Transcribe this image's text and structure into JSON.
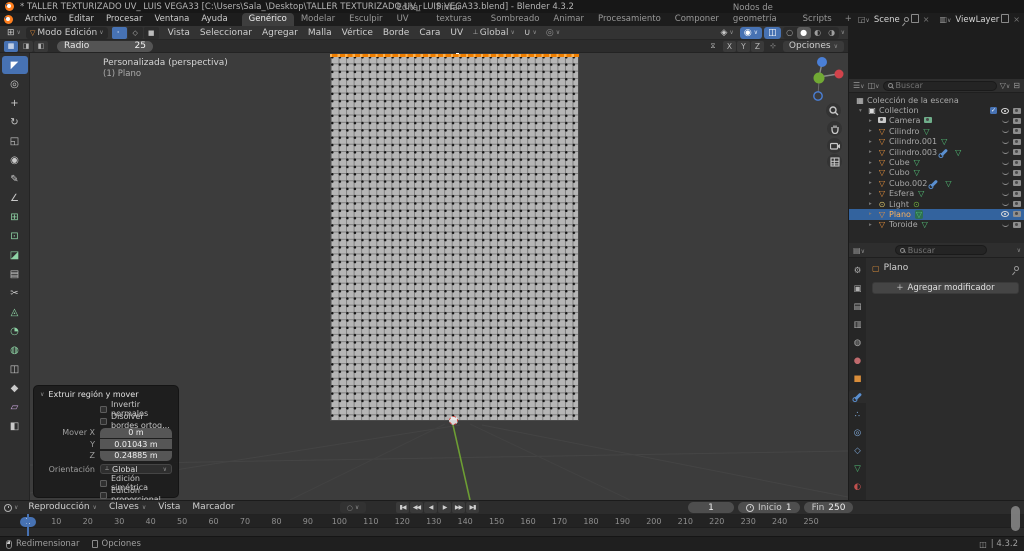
{
  "colors": {
    "accent_blue": "#4772b3",
    "selection_orange": "#ff9a2a",
    "mesh_data_green": "#53c278",
    "object_orange": "#e8913c",
    "axis_x_red": "#d1434b",
    "axis_y_green": "#71a934",
    "axis_z_blue": "#4a7fd6"
  },
  "titlebar": {
    "title": "* TALLER TEXTURIZADO UV_ LUIS VEGA33 [C:\\Users\\Sala_\\Desktop\\TALLER TEXTURIZADO UV_ LUIS VEGA33.blend] - Blender 4.3.2"
  },
  "topbar": {
    "menus": [
      "Archivo",
      "Editar",
      "Procesar",
      "Ventana",
      "Ayuda"
    ],
    "workspaces": [
      "Genérico",
      "Modelar",
      "Esculpir",
      "Editar UV",
      "Pintar texturas",
      "Sombreado",
      "Animar",
      "Procesamiento",
      "Componer",
      "Nodos de geometría",
      "Scripts"
    ],
    "active_workspace": "Genérico",
    "new_workspace_button": "+",
    "scene_label": "Scene",
    "viewlayer_label": "ViewLayer"
  },
  "viewport_header": {
    "mode_label": "Modo Edición",
    "menus": [
      "Vista",
      "Seleccionar",
      "Agregar",
      "Malla",
      "Vértice",
      "Borde",
      "Cara",
      "UV"
    ],
    "orientation_label": "Global",
    "select_mode_glyphs": [
      "⠂",
      "◇",
      "■"
    ],
    "shading_glyphs": [
      "○",
      "●",
      "◐",
      "◑"
    ],
    "active_shading_index": 1
  },
  "tool_settings": {
    "radius_label": "Radio",
    "radius_value": "25",
    "mirror_axes": [
      "X",
      "Y",
      "Z"
    ],
    "options_label": "Opciones"
  },
  "toolbar": {
    "tools": [
      {
        "name": "select-box",
        "glyph": "◤",
        "color": "#ffffff",
        "active": true
      },
      {
        "name": "cursor",
        "glyph": "◎",
        "color": "#c9c9c9"
      },
      {
        "name": "move",
        "glyph": "+",
        "color": "#c9c9c9"
      },
      {
        "name": "rotate",
        "glyph": "↻",
        "color": "#c9c9c9"
      },
      {
        "name": "scale",
        "glyph": "◱",
        "color": "#c9c9c9"
      },
      {
        "name": "transform",
        "glyph": "◉",
        "color": "#c9c9c9"
      },
      {
        "name": "annotate",
        "glyph": "✎",
        "color": "#c9c9c9"
      },
      {
        "name": "measure",
        "glyph": "∠",
        "color": "#c9c9c9"
      },
      {
        "name": "extrude-region",
        "glyph": "⊞",
        "color": "#8fd5a6"
      },
      {
        "name": "inset-faces",
        "glyph": "⊡",
        "color": "#8fd5a6"
      },
      {
        "name": "bevel",
        "glyph": "◪",
        "color": "#8fd5a6"
      },
      {
        "name": "loop-cut",
        "glyph": "▤",
        "color": "#c9c9c9"
      },
      {
        "name": "knife",
        "glyph": "✂",
        "color": "#c9c9c9"
      },
      {
        "name": "poly-build",
        "glyph": "◬",
        "color": "#8fd5a6"
      },
      {
        "name": "spin",
        "glyph": "◔",
        "color": "#8fd5a6"
      },
      {
        "name": "smooth",
        "glyph": "◍",
        "color": "#8fd5a6"
      },
      {
        "name": "edge-slide",
        "glyph": "◫",
        "color": "#c9c9c9"
      },
      {
        "name": "shrink-fatten",
        "glyph": "◆",
        "color": "#c9c9c9"
      },
      {
        "name": "shear",
        "glyph": "▱",
        "color": "#cda9e0"
      },
      {
        "name": "rip-region",
        "glyph": "◧",
        "color": "#c9c9c9"
      }
    ]
  },
  "viewport": {
    "view_name": "Personalizada (perspectiva)",
    "active_object": "(1) Plano"
  },
  "operator_panel": {
    "title": "Extruir región y mover",
    "checkbox_invert": "Invertir normales",
    "checkbox_dissolve": "Disolver bordes ortog...",
    "move_x_label": "Mover X",
    "move_x_value": "0 m",
    "move_y_label": "Y",
    "move_y_value": "0.01043 m",
    "move_z_label": "Z",
    "move_z_value": "0.24885 m",
    "orientation_label": "Orientación",
    "orientation_value": "Global",
    "checkbox_symmetric": "Edición simétrica",
    "checkbox_proportional": "Edición proporcional"
  },
  "outliner": {
    "search_placeholder": "Buscar",
    "scene_collection_label": "Colección de la escena",
    "collection_label": "Collection",
    "items": [
      {
        "name": "Camera",
        "type": "camera",
        "has_modifier": false,
        "selected": false
      },
      {
        "name": "Cilindro",
        "type": "mesh",
        "has_modifier": false,
        "selected": false
      },
      {
        "name": "Cilindro.001",
        "type": "mesh",
        "has_modifier": false,
        "selected": false
      },
      {
        "name": "Cilindro.003",
        "type": "mesh",
        "has_modifier": true,
        "selected": false
      },
      {
        "name": "Cube",
        "type": "mesh",
        "has_modifier": false,
        "selected": false
      },
      {
        "name": "Cubo",
        "type": "mesh",
        "has_modifier": false,
        "selected": false
      },
      {
        "name": "Cubo.002",
        "type": "mesh",
        "has_modifier": true,
        "selected": false
      },
      {
        "name": "Esfera",
        "type": "mesh",
        "has_modifier": false,
        "selected": false
      },
      {
        "name": "Light",
        "type": "light",
        "has_modifier": false,
        "selected": false
      },
      {
        "name": "Plano",
        "type": "mesh",
        "has_modifier": false,
        "selected": true
      },
      {
        "name": "Toroide",
        "type": "mesh",
        "has_modifier": false,
        "selected": false
      }
    ]
  },
  "properties": {
    "search_placeholder": "Buscar",
    "breadcrumb_object": "Plano",
    "add_modifier_label": "Agregar modificador",
    "tabs": [
      {
        "name": "tool",
        "glyph": "⚙",
        "color": "#b0b0b0",
        "active": false
      },
      {
        "name": "render",
        "glyph": "▣",
        "color": "#b0b0b0",
        "active": false
      },
      {
        "name": "output",
        "glyph": "▤",
        "color": "#b0b0b0",
        "active": false
      },
      {
        "name": "view-layer",
        "glyph": "▥",
        "color": "#b0b0b0",
        "active": false
      },
      {
        "name": "scene",
        "glyph": "◍",
        "color": "#b0b0b0",
        "active": false
      },
      {
        "name": "world",
        "glyph": "●",
        "color": "#c06a6d",
        "active": false
      },
      {
        "name": "object",
        "glyph": "■",
        "color": "#d98d3a",
        "active": false
      },
      {
        "name": "modifiers",
        "glyph": "wrench",
        "color": "#5a8fd0",
        "active": true
      },
      {
        "name": "particles",
        "glyph": "∴",
        "color": "#7fa8d8",
        "active": false
      },
      {
        "name": "physics",
        "glyph": "◎",
        "color": "#7fa8d8",
        "active": false
      },
      {
        "name": "constraints",
        "glyph": "◇",
        "color": "#7fa8d8",
        "active": false
      },
      {
        "name": "object-data",
        "glyph": "▽",
        "color": "#53c278",
        "active": false
      },
      {
        "name": "material",
        "glyph": "◐",
        "color": "#c0504e",
        "active": false
      }
    ]
  },
  "timeline": {
    "menus": [
      {
        "label": "Reproducción",
        "arrow": true
      },
      {
        "label": "Claves",
        "arrow": true
      },
      {
        "label": "Vista",
        "arrow": false
      },
      {
        "label": "Marcador",
        "arrow": false
      }
    ],
    "playback_glyphs": [
      "▮◀",
      "◀◀",
      "◀",
      "▶",
      "▶▶",
      "▶▮"
    ],
    "current_frame": "1",
    "frame_field_value": "1",
    "start_label": "Inicio",
    "start_value": "1",
    "end_label": "Fin",
    "end_value": "250",
    "ticks": [
      10,
      20,
      30,
      40,
      50,
      60,
      70,
      80,
      90,
      100,
      110,
      120,
      130,
      140,
      150,
      160,
      170,
      180,
      190,
      200,
      210,
      220,
      230,
      240,
      250
    ]
  },
  "statusbar": {
    "left_items": [
      "Redimensionar",
      "Opciones"
    ],
    "version": "| 4.3.2"
  }
}
